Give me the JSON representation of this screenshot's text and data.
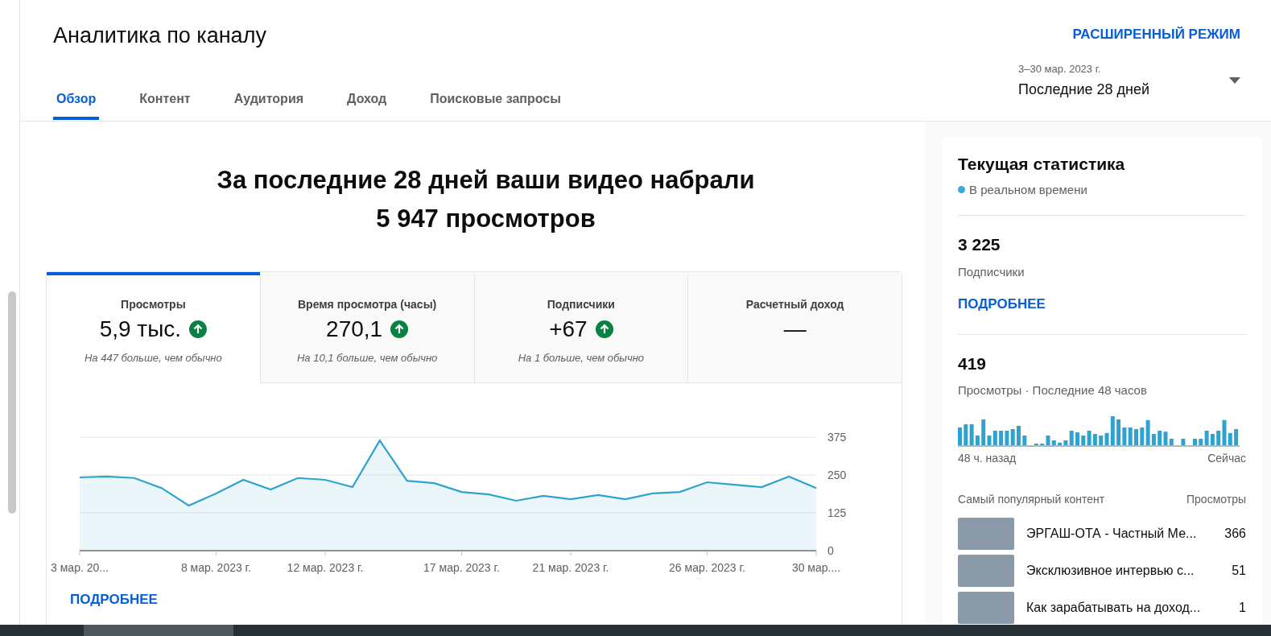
{
  "header": {
    "title": "Аналитика по каналу",
    "advanced_mode": "РАСШИРЕННЫЙ РЕЖИМ"
  },
  "tabs": [
    {
      "label": "Обзор",
      "selected": true
    },
    {
      "label": "Контент",
      "selected": false
    },
    {
      "label": "Аудитория",
      "selected": false
    },
    {
      "label": "Доход",
      "selected": false
    },
    {
      "label": "Поисковые запросы",
      "selected": false
    }
  ],
  "date_range": {
    "dates": "3–30 мар. 2023 г.",
    "period": "Последние 28 дней"
  },
  "summary": {
    "line_1": "За последние 28 дней ваши видео набрали",
    "line_2": "5 947 просмотров"
  },
  "metrics": [
    {
      "label": "Просмотры",
      "value": "5,9 тыс.",
      "rising": true,
      "note": "На 447 больше, чем обычно",
      "selected": true
    },
    {
      "label": "Время просмотра (часы)",
      "value": "270,1",
      "rising": true,
      "note": "На 10,1 больше, чем обычно",
      "selected": false
    },
    {
      "label": "Подписчики",
      "value": "+67",
      "rising": true,
      "note": "На 1 больше, чем обычно",
      "selected": false
    },
    {
      "label": "Расчетный доход",
      "value": "—",
      "selected": false
    }
  ],
  "chart_data": {
    "type": "area",
    "categories": [
      "3 мар. 20...",
      null,
      null,
      null,
      null,
      "8 мар. 2023 г.",
      null,
      null,
      null,
      "12 мар. 2023 г.",
      null,
      null,
      null,
      null,
      "17 мар. 2023 г.",
      null,
      null,
      null,
      "21 мар. 2023 г.",
      null,
      null,
      null,
      null,
      "26 мар. 2023 г.",
      null,
      null,
      null,
      "30 мар...."
    ],
    "series": [
      {
        "color": "#2ea3d0",
        "values": [
          242,
          245,
          240,
          207,
          149,
          189,
          234,
          202,
          240,
          234,
          210,
          364,
          231,
          223,
          194,
          186,
          165,
          181,
          170,
          184,
          170,
          189,
          194,
          226,
          218,
          210,
          245,
          207
        ]
      }
    ],
    "yticks": [
      0,
      125,
      250,
      375
    ],
    "ylim": [
      0,
      375
    ]
  },
  "more_link": "ПОДРОБНЕЕ",
  "realtime": {
    "title": "Текущая статистика",
    "live_label": "В реальном времени",
    "subscribers": {
      "value": "3 225",
      "label": "Подписчики",
      "link": "ПОДРОБНЕЕ"
    },
    "views": {
      "value": "419",
      "label": "Просмотры · Последние 48 часов",
      "start_label": "48 ч. назад",
      "end_label": "Сейчас"
    },
    "top_content": {
      "header": "Самый популярный контент",
      "views_header": "Просмотры",
      "items": [
        {
          "title": "ЭРГАШ-ОТА - Частный Ме...",
          "views": "366"
        },
        {
          "title": "Эксклюзивное интервью с...",
          "views": "51"
        },
        {
          "title": "Как зарабатывать на доход...",
          "views": "1"
        }
      ]
    }
  }
}
